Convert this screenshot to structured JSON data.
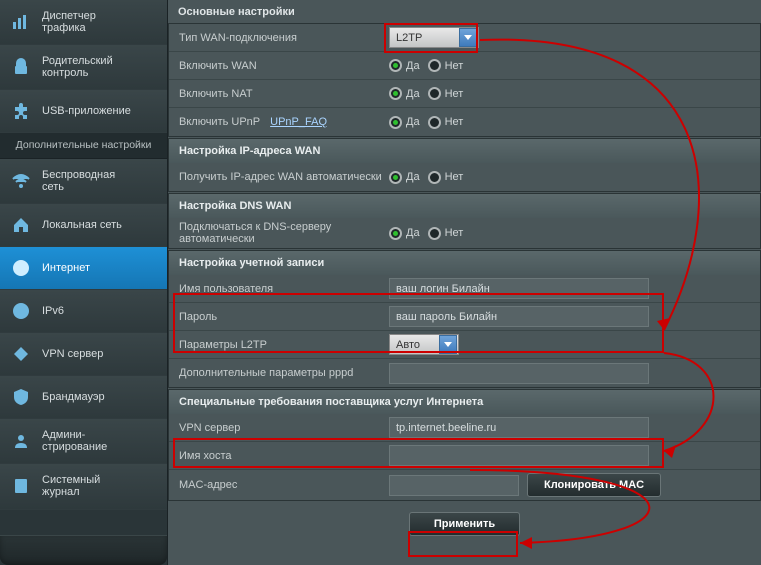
{
  "sidebar": {
    "top_items": [
      {
        "label": "Диспетчер\nтрафика",
        "icon": "chart-bars"
      },
      {
        "label": "Родительский\nконтроль",
        "icon": "lock"
      },
      {
        "label": "USB-приложение",
        "icon": "puzzle"
      }
    ],
    "section_title": "Дополнительные настройки",
    "nav_items": [
      {
        "label": "Беспроводная\nсеть",
        "icon": "wifi",
        "active": false
      },
      {
        "label": "Локальная сеть",
        "icon": "home",
        "active": false
      },
      {
        "label": "Интернет",
        "icon": "globe",
        "active": true
      },
      {
        "label": "IPv6",
        "icon": "ip",
        "active": false
      },
      {
        "label": "VPN сервер",
        "icon": "vpn",
        "active": false
      },
      {
        "label": "Брандмауэр",
        "icon": "shield",
        "active": false
      },
      {
        "label": "Админи-\nстрирование",
        "icon": "admin",
        "active": false
      },
      {
        "label": "Системный\nжурнал",
        "icon": "notes",
        "active": false
      }
    ]
  },
  "sections": {
    "basic": {
      "title": "Основные настройки",
      "conn_type_label": "Тип WAN-подключения",
      "conn_type_value": "L2TP",
      "enable_wan_label": "Включить WAN",
      "enable_nat_label": "Включить NAT",
      "enable_upnp_label": "Включить UPnP",
      "upnp_faq": "UPnP_FAQ",
      "yes": "Да",
      "no": "Нет"
    },
    "wan_ip": {
      "title": "Настройка IP-адреса WAN",
      "auto_label": "Получить IP-адрес WAN автоматически"
    },
    "dns": {
      "title": "Настройка DNS WAN",
      "auto_label": "Подключаться к DNS-серверу\nавтоматически"
    },
    "account": {
      "title": "Настройка учетной записи",
      "user_label": "Имя пользователя",
      "user_value": "ваш логин Билайн",
      "pass_label": "Пароль",
      "pass_value": "ваш пароль Билайн",
      "l2tp_label": "Параметры L2TP",
      "l2tp_value": "Авто",
      "pppd_label": "Дополнительные параметры pppd"
    },
    "isp": {
      "title": "Специальные требования поставщика услуг Интернета",
      "vpn_label": "VPN сервер",
      "vpn_value": "tp.internet.beeline.ru",
      "host_label": "Имя хоста",
      "mac_label": "MAC-адрес",
      "clone_mac": "Клонировать MAC"
    },
    "apply": "Применить"
  }
}
